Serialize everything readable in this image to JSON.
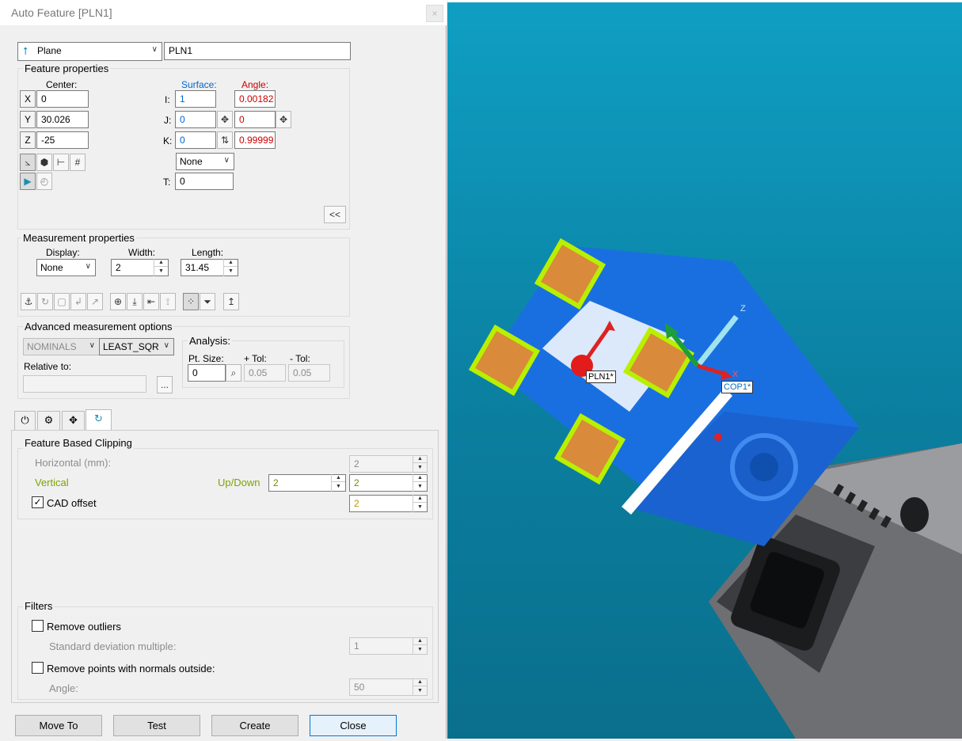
{
  "window": {
    "title": "Auto Feature [PLN1]",
    "close": "×"
  },
  "feature": {
    "type": "Plane",
    "name": "PLN1"
  },
  "feature_properties": {
    "title": "Feature properties",
    "center_label": "Center:",
    "surface_label": "Surface:",
    "angle_label": "Angle:",
    "x_btn": "X",
    "y_btn": "Y",
    "z_btn": "Z",
    "x": "0",
    "y": "30.026",
    "z": "-25",
    "i_label": "I:",
    "j_label": "J:",
    "k_label": "K:",
    "i": "1",
    "j": "0",
    "k": "0",
    "angle_i": "0.00182",
    "angle_j": "0",
    "angle_k": "0.99999",
    "mode": "None",
    "t_label": "T:",
    "t": "0",
    "collapse_btn": "<<"
  },
  "measurement_properties": {
    "title": "Measurement properties",
    "display_label": "Display:",
    "display": "None",
    "width_label": "Width:",
    "width": "2",
    "length_label": "Length:",
    "length": "31.45"
  },
  "advanced": {
    "title": "Advanced measurement options",
    "nominals": "NOMINALS",
    "fit": "LEAST_SQR",
    "relative_label": "Relative to:",
    "relative": "",
    "browse": "...",
    "analysis_label": "Analysis:",
    "ptsize_label": "Pt. Size:",
    "ptsize": "0",
    "plustol_label": "+ Tol:",
    "plustol": "0.05",
    "minustol_label": "- Tol:",
    "minustol": "0.05"
  },
  "clipping": {
    "title": "Feature Based Clipping",
    "horizontal_label": "Horizontal (mm):",
    "horizontal": "2",
    "vertical_label": "Vertical",
    "updown_label": "Up/Down",
    "updown": "2",
    "vertical": "2",
    "cad_offset_label": "CAD offset",
    "cad_offset": "2"
  },
  "filters": {
    "title": "Filters",
    "remove_outliers": "Remove outliers",
    "std_label": "Standard deviation multiple:",
    "std": "1",
    "remove_normals": "Remove points with normals outside:",
    "angle_label": "Angle:",
    "angle": "50"
  },
  "buttons": {
    "move_to": "Move To",
    "test": "Test",
    "create": "Create",
    "close": "Close"
  },
  "viewport": {
    "plane_tag": "PLN1*",
    "cop_tag": "COP1*",
    "axis_x": "X",
    "axis_z": "Z"
  },
  "colors": {
    "viewport_bg": "#0b8fb3",
    "part": "#1a6fe0",
    "patch_border": "#b8f000",
    "patch": "#d98a3a"
  }
}
